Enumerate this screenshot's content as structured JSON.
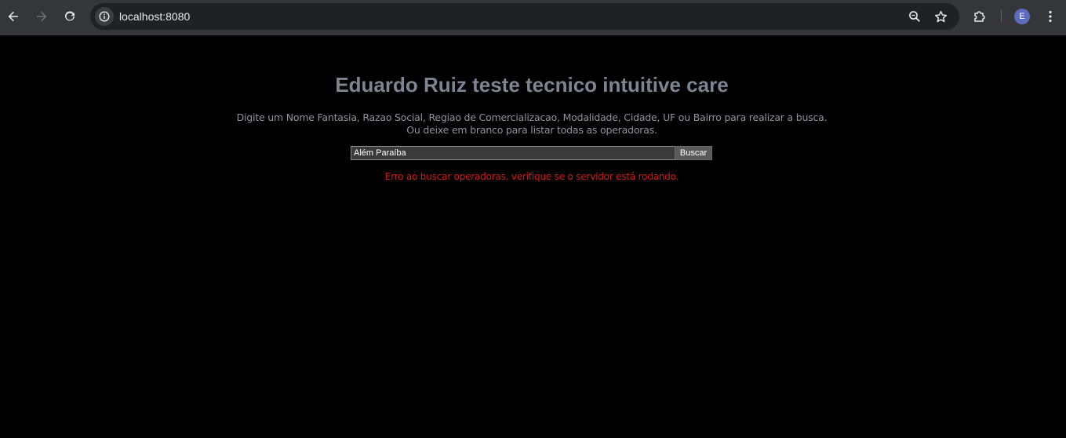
{
  "browser": {
    "url": "localhost:8080",
    "profile_initial": "E",
    "icons": [
      "back-arrow-icon",
      "forward-arrow-icon",
      "reload-icon",
      "site-info-icon",
      "zoom-icon",
      "bookmark-star-icon",
      "extensions-icon",
      "avatar",
      "kebab-menu-icon"
    ]
  },
  "page": {
    "title": "Eduardo Ruiz teste tecnico intuitive care",
    "instruction_line1": "Digite um Nome Fantasia, Razao Social, Regiao de Comercializacao, Modalidade, Cidade, UF ou Bairro para realizar a busca.",
    "instruction_line2": "Ou deixe em branco para listar todas as operadoras.",
    "search_value": "Além Paraíba",
    "search_button_label": "Buscar",
    "error_message": "Erro ao buscar operadoras. verifique se o servidor está rodando."
  },
  "colors": {
    "background": "#000000",
    "title": "#7d8592",
    "error": "#d21a1a"
  }
}
